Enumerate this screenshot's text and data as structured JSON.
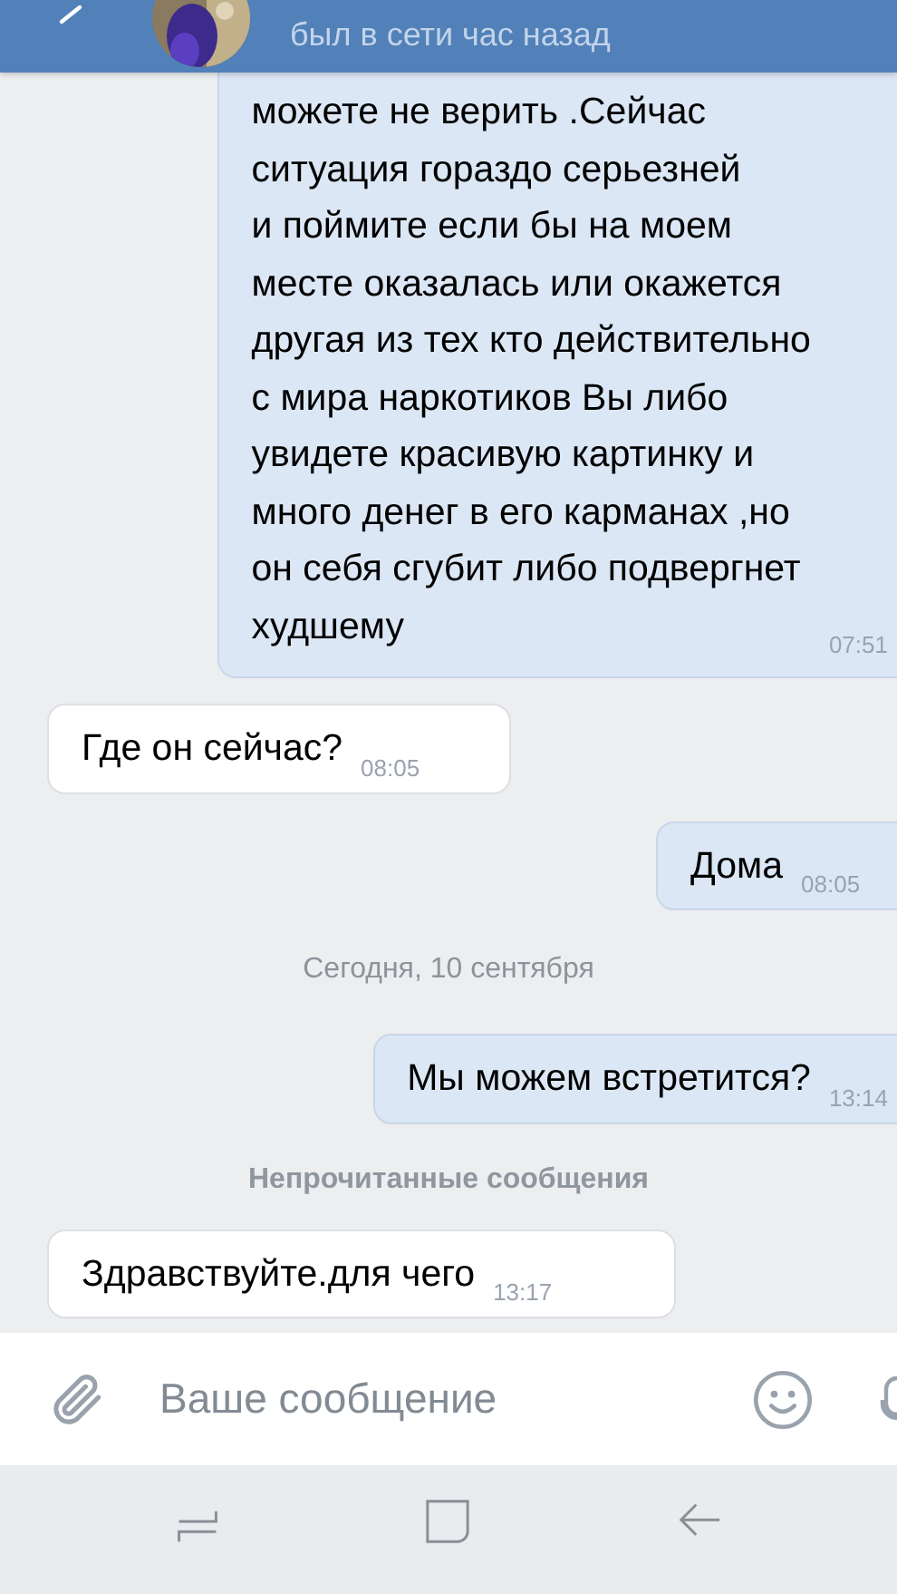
{
  "header": {
    "status": "был в сети час назад"
  },
  "messages": [
    {
      "kind": "message",
      "outgoing": true,
      "text": "можете не верить  .Сейчас\nситуация гораздо серьезней\nи поймите если бы на моем\nместе оказалась или окажется\nдругая из тех кто действительно\nс мира наркотиков Вы либо\nувидете красивую картинку и\nмного денег в его карманах ,но\nон себя сгубит либо подвергнет\nхудшему",
      "time": "07:51"
    },
    {
      "kind": "message",
      "outgoing": false,
      "text": "Где он сейчас?",
      "time": "08:05"
    },
    {
      "kind": "message",
      "outgoing": true,
      "text": "Дома",
      "time": "08:05"
    },
    {
      "kind": "date",
      "text": "Сегодня, 10 сентября"
    },
    {
      "kind": "message",
      "outgoing": true,
      "text": "Мы можем встретится?",
      "time": "13:14"
    },
    {
      "kind": "divider",
      "text": "Непрочитанные сообщения"
    },
    {
      "kind": "message",
      "outgoing": false,
      "text": "Здравствуйте.для чего",
      "time": "13:17"
    }
  ],
  "composer": {
    "placeholder": "Ваше сообщение"
  }
}
